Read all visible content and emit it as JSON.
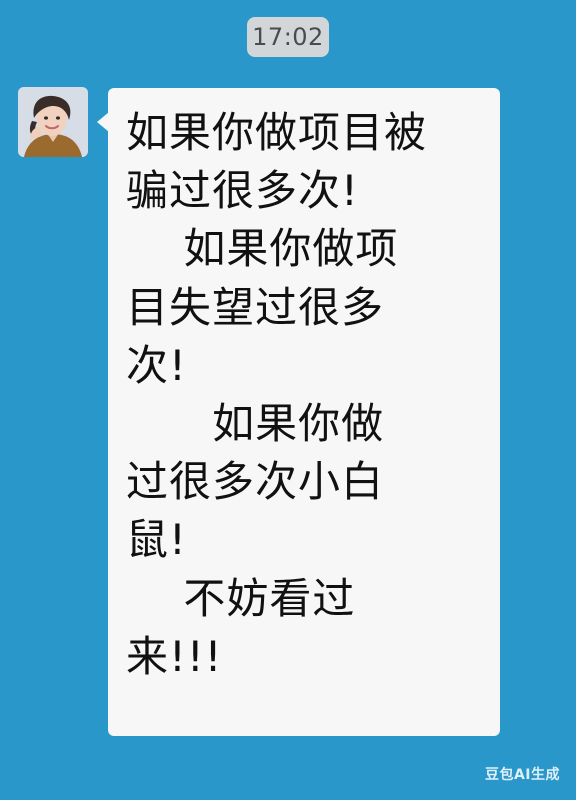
{
  "chat": {
    "timestamp": "17:02",
    "message": {
      "text": "如果你做项目被\n骗过很多次!\n    如果你做项\n目失望过很多\n次!\n      如果你做\n过很多次小白\n鼠!\n    不妨看过\n来!!!"
    },
    "avatar": {
      "alt": "avatar"
    }
  },
  "watermark": {
    "text": "豆包AI生成"
  },
  "colors": {
    "background": "#2a97cb",
    "bubble": "#f7f7f7",
    "timestamp_bg": "#d3d6d8"
  }
}
